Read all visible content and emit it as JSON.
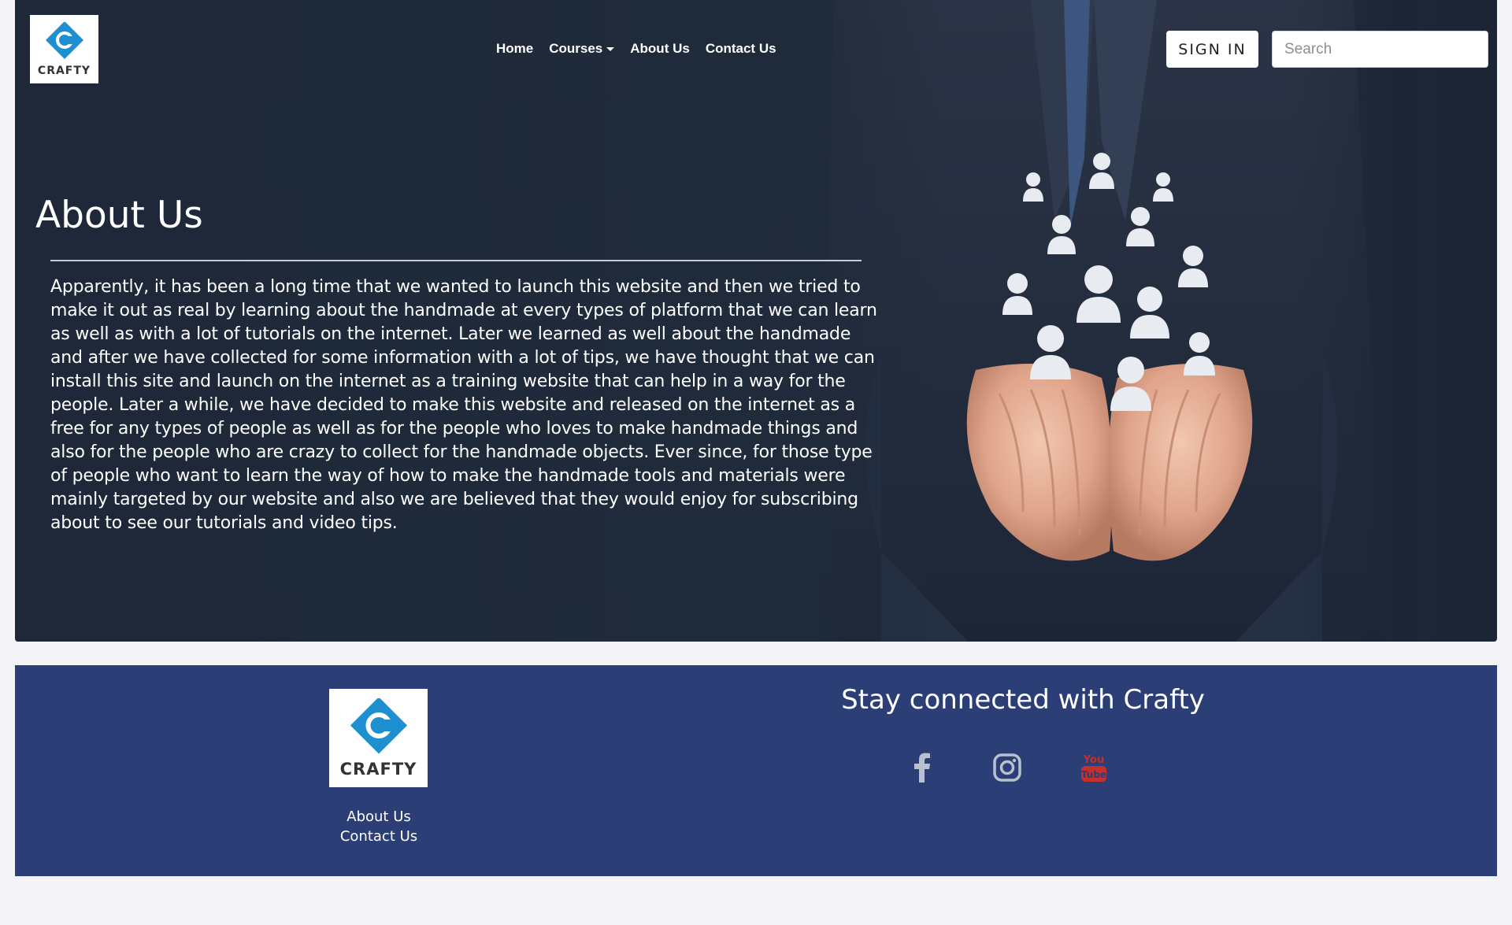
{
  "brand": {
    "logo_text": "CRAFTY"
  },
  "nav": {
    "items": [
      {
        "label": "Home"
      },
      {
        "label": "Courses"
      },
      {
        "label": "About Us"
      },
      {
        "label": "Contact Us"
      }
    ]
  },
  "header": {
    "signin_label": "SIGN IN",
    "search_placeholder": "Search",
    "search_value": ""
  },
  "hero": {
    "title": "About Us",
    "body": "Apparently, it has been a long time that we wanted to launch this website and then we tried to make it out as real by learning about the handmade at every types of platform that we can learn as well as with a lot of tutorials on the internet. Later we learned as well about the handmade and after we have collected for some information with a lot of tips, we have thought that we can install this site and launch on the internet as a training website that can help in a way for the people. Later a while, we have decided to make this website and released on the internet as a free for any types of people as well as for the people who loves to make handmade things and also for the people who are crazy to collect for the handmade objects. Ever since, for those type of people who want to learn the way of how to make the handmade tools and materials were mainly targeted by our website and also we are believed that they would enjoy for subscribing about to see our tutorials and video tips."
  },
  "footer": {
    "logo_text": "CRAFTY",
    "links": [
      {
        "label": "About Us"
      },
      {
        "label": "Contact Us"
      }
    ],
    "stay_connected": "Stay connected with Crafty",
    "social": [
      {
        "icon": "facebook-icon"
      },
      {
        "icon": "instagram-icon"
      },
      {
        "icon": "youtube-icon",
        "label": "You Tube"
      }
    ]
  },
  "colors": {
    "hero_bg": "#1f2a3b",
    "footer_bg": "#2c3e76",
    "logo_blue": "#1e8fd0",
    "youtube_red": "#c4302b",
    "page_bg": "#f4f4f7"
  }
}
